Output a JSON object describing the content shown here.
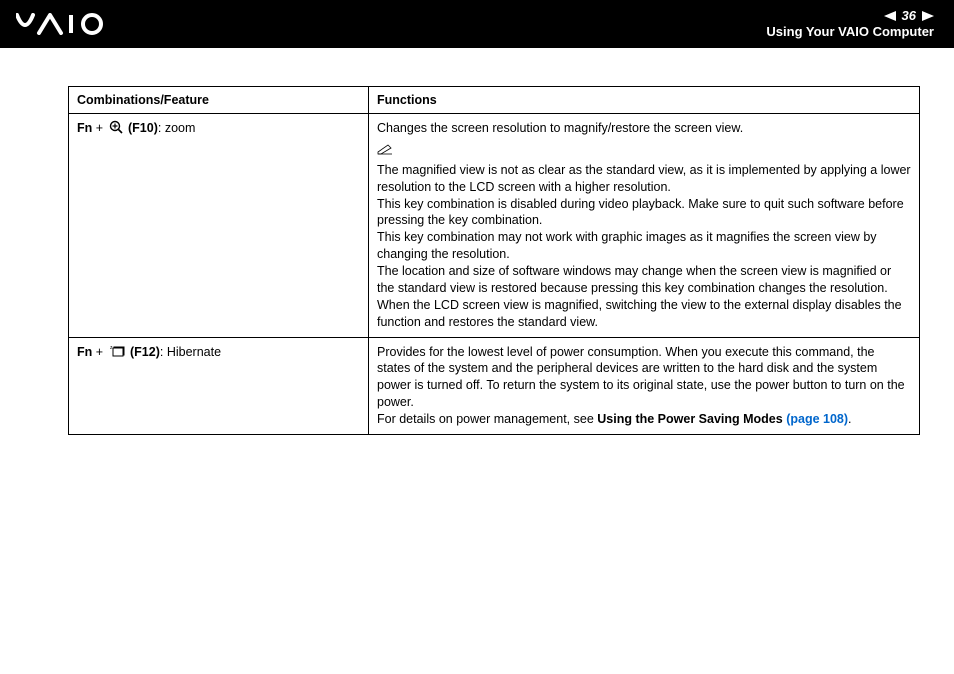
{
  "header": {
    "page_number": "36",
    "section_title": "Using Your VAIO Computer"
  },
  "table": {
    "headers": {
      "col1": "Combinations/Feature",
      "col2": "Functions"
    },
    "rows": [
      {
        "combo_prefix": "Fn",
        "combo_plus": " + ",
        "combo_key": " (F10)",
        "combo_desc": ": zoom",
        "func_main": "Changes the screen resolution to magnify/restore the screen view.",
        "notes": [
          "The magnified view is not as clear as the standard view, as it is implemented by applying a lower resolution to the LCD screen with a higher resolution.",
          "This key combination is disabled during video playback. Make sure to quit such software before pressing the key combination.",
          "This key combination may not work with graphic images as it magnifies the screen view by changing the resolution.",
          "The location and size of software windows may change when the screen view is magnified or the standard view is restored because pressing this key combination changes the resolution.",
          "When the LCD screen view is magnified, switching the view to the external display disables the function and restores the standard view."
        ]
      },
      {
        "combo_prefix": "Fn",
        "combo_plus": " + ",
        "combo_key": " (F12)",
        "combo_desc": ": Hibernate",
        "func_main": "Provides for the lowest level of power consumption. When you execute this command, the states of the system and the peripheral devices are written to the hard disk and the system power is turned off. To return the system to its original state, use the power button to turn on the power.",
        "detail_prefix": "For details on power management, see ",
        "detail_bold": "Using the Power Saving Modes ",
        "detail_link": "(page 108)",
        "detail_suffix": "."
      }
    ]
  }
}
